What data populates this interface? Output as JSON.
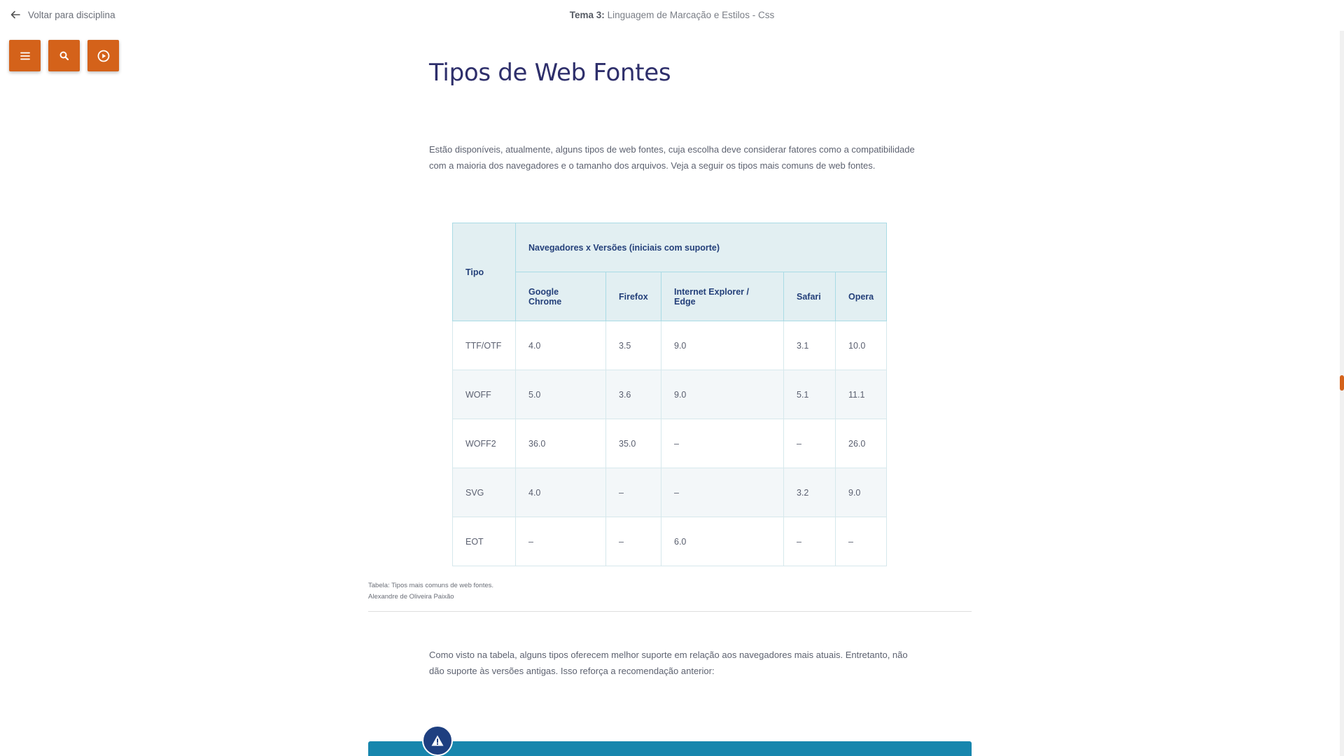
{
  "nav": {
    "back_label": "Voltar para disciplina",
    "topic_prefix": "Tema 3:",
    "topic_name": "Linguagem de Marcação e Estilos - Css"
  },
  "toolbar": {
    "menu_icon": "menu-icon",
    "search_icon": "search-icon",
    "play_icon": "play-circle-icon",
    "accent_color": "#d4621a"
  },
  "content": {
    "title": "Tipos de Web Fontes",
    "intro": "Estão disponíveis, atualmente, alguns tipos de web fontes, cuja escolha deve considerar fatores como a compatibilidade com a maioria dos navegadores e o tamanho dos arquivos. Veja a seguir os tipos mais comuns de web fontes.",
    "table": {
      "header_tipo": "Tipo",
      "header_group": "Navegadores x Versões (iniciais com suporte)",
      "columns": [
        "Google Chrome",
        "Firefox",
        "Internet Explorer / Edge",
        "Safari",
        "Opera"
      ],
      "rows": [
        [
          "TTF/OTF",
          "4.0",
          "3.5",
          "9.0",
          "3.1",
          "10.0"
        ],
        [
          "WOFF",
          "5.0",
          "3.6",
          "9.0",
          "5.1",
          "11.1"
        ],
        [
          "WOFF2",
          "36.0",
          "35.0",
          "–",
          "–",
          "26.0"
        ],
        [
          "SVG",
          "4.0",
          "–",
          "–",
          "3.2",
          "9.0"
        ],
        [
          "EOT",
          "–",
          "–",
          "6.0",
          "–",
          "–"
        ]
      ]
    },
    "caption_line1": "Tabela: Tipos mais comuns de web fontes.",
    "caption_line2": "Alexandre de Oliveira Paixão",
    "after_table": "Como visto na tabela, alguns tipos oferecem melhor suporte em relação aos navegadores mais atuais. Entretanto, não dão suporte às versões antigas. Isso reforça a recomendação anterior:"
  },
  "alert": {
    "icon": "warning-icon",
    "color": "#1786ad"
  }
}
